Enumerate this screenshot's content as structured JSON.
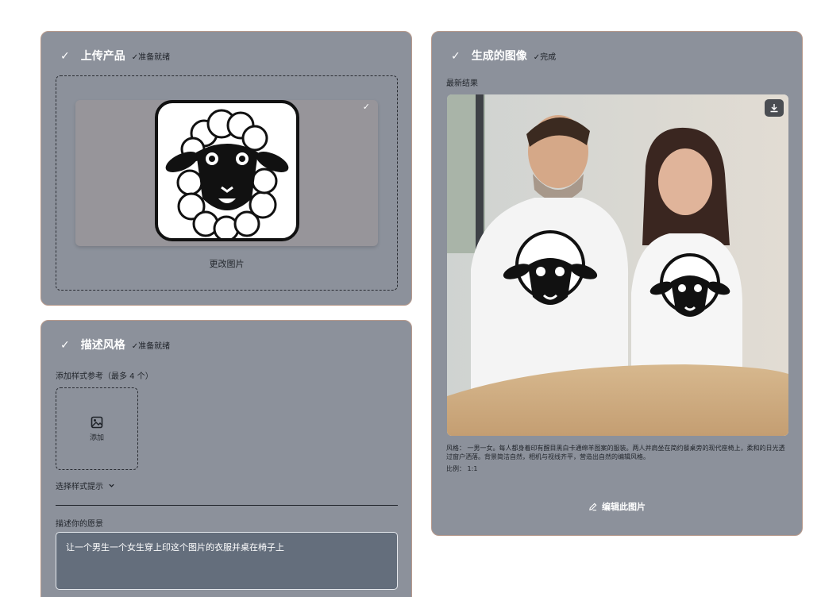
{
  "upload": {
    "title": "上传产品",
    "status": "✓准备就绪",
    "change_image": "更改图片"
  },
  "style": {
    "title": "描述风格",
    "status": "✓准备就绪",
    "ref_label": "添加样式参考（最多 4 个）",
    "add_label": "添加",
    "hint_label": "选择样式提示",
    "vision_label": "描述你的愿景",
    "vision_value": "让一个男生一个女生穿上印这个图片的衣服并桌在椅子上"
  },
  "generated": {
    "title": "生成的图像",
    "status": "✓完成",
    "latest_label": "最新结果",
    "description": "风格： 一男一女。每人都身着印有醒目黑白卡通绵羊图案的服装。两人并肩坐在简约餐桌旁的现代座椅上，柔和的日光透过窗户洒落。背景简洁自然，相机与视线齐平，营造出自然的编辑风格。",
    "ratio": "比例： 1:1",
    "edit_label": "编辑此图片"
  },
  "icons": {
    "check": "check-icon",
    "image": "image-icon",
    "chevron": "chevron-down-icon",
    "download": "download-icon",
    "pencil": "pencil-icon"
  },
  "colors": {
    "card_bg": "#8c919b",
    "input_bg": "#646e7c",
    "border_accent": "#b89a8c"
  }
}
